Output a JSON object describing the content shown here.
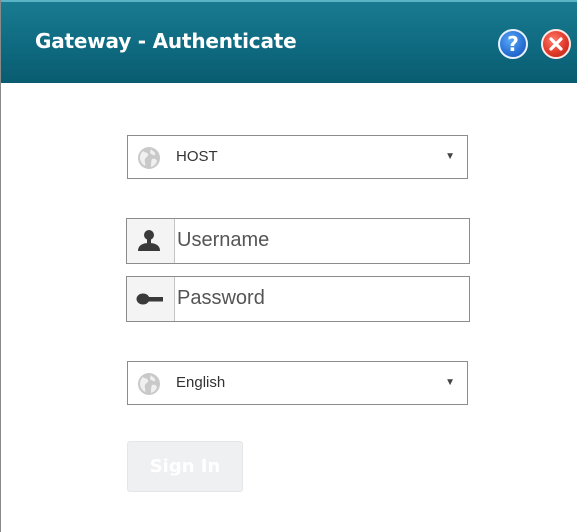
{
  "window": {
    "title": "Gateway - Authenticate",
    "help_icon": "help-icon",
    "close_icon": "close-icon",
    "titlebar_color": "#0e6a80"
  },
  "form": {
    "host_select": {
      "selected": "HOST",
      "icon": "globe-icon"
    },
    "username": {
      "placeholder": "Username",
      "value": "",
      "icon": "user-icon"
    },
    "password": {
      "placeholder": "Password",
      "value": "",
      "icon": "key-icon"
    },
    "language_select": {
      "selected": "English",
      "icon": "globe-icon"
    },
    "signin_label": "Sign In"
  }
}
